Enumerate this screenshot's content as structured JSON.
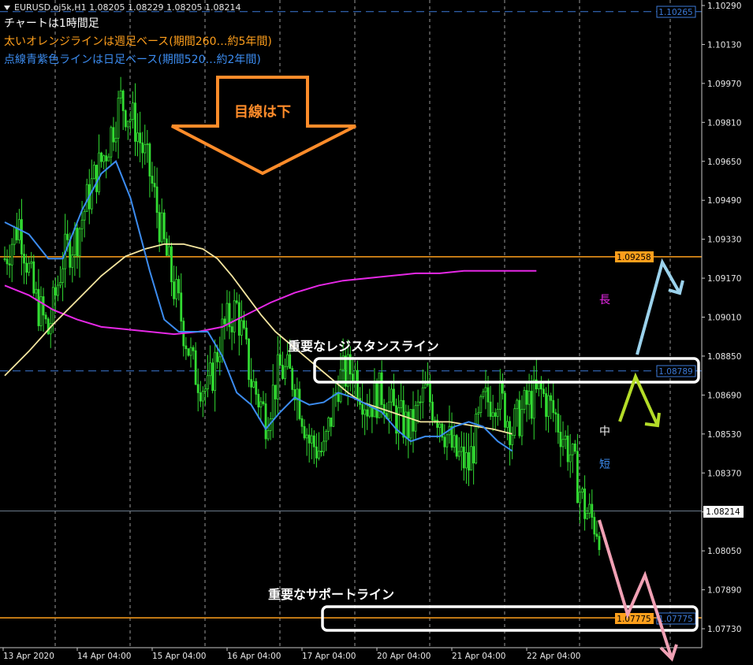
{
  "header": {
    "symbol_line": "EURUSD.oj5k,H1  1.08205 1.08229 1.08205 1.08214",
    "line1": "チャートは1時間足",
    "line2": "太いオレンジラインは週足ベース(期間260…約5年間)",
    "line3": "点線青紫色ラインは日足ベース(期間520…約2年間)"
  },
  "annotations": {
    "arrow_text": "目線は下",
    "resistance": "重要なレジスタンスライン",
    "support": "重要なサポートライン",
    "ma_long": "長",
    "ma_mid": "中",
    "ma_short": "短"
  },
  "price_labels": {
    "top_blue": "1.10265",
    "orange_upper": "1.09258",
    "blue_mid": "1.08789",
    "current": "1.08214",
    "orange_lower": "1.07775",
    "blue_lower": "1.07775"
  },
  "colors": {
    "background": "#000000",
    "candle": "#32dc32",
    "ma_short": "#3c8cf0",
    "ma_mid": "#f5e6a0",
    "ma_long": "#e628e6",
    "orange_line": "#ff9f1c",
    "blue_dash": "#3c7ad8",
    "arrow_orange": "#ff8c2a",
    "arrow_lightblue": "#9bd2ec",
    "arrow_yellowgreen": "#b4dc28",
    "arrow_pink": "#f0a0b4"
  },
  "chart_data": {
    "type": "candlestick",
    "timeframe": "H1",
    "ylim": [
      1.0765,
      1.1031
    ],
    "y_ticks": [
      "1.10290",
      "1.10130",
      "1.09970",
      "1.09810",
      "1.09650",
      "1.09490",
      "1.09330",
      "1.09170",
      "1.09010",
      "1.08850",
      "1.08690",
      "1.08530",
      "1.08370",
      "1.08210",
      "1.08050",
      "1.07890",
      "1.07730"
    ],
    "x_ticks": [
      "13 Apr 2020",
      "14 Apr 04:00",
      "15 Apr 04:00",
      "16 Apr 04:00",
      "17 Apr 04:00",
      "20 Apr 04:00",
      "21 Apr 04:00",
      "22 Apr 04:00"
    ],
    "last": {
      "open": 1.08205,
      "high": 1.08229,
      "low": 1.08205,
      "close": 1.08214
    },
    "horizontal_lines": [
      {
        "value": 1.10265,
        "style": "dashed",
        "color": "blue"
      },
      {
        "value": 1.09258,
        "style": "solid",
        "color": "orange"
      },
      {
        "value": 1.08789,
        "style": "dashed",
        "color": "blue"
      },
      {
        "value": 1.07775,
        "style": "solid",
        "color": "orange"
      }
    ],
    "close_path": [
      [
        0,
        1.0925
      ],
      [
        6,
        1.094
      ],
      [
        12,
        1.091
      ],
      [
        18,
        1.0895
      ],
      [
        24,
        1.0925
      ],
      [
        30,
        1.0935
      ],
      [
        36,
        1.0955
      ],
      [
        42,
        1.097
      ],
      [
        48,
        1.099
      ],
      [
        54,
        1.098
      ],
      [
        60,
        1.096
      ],
      [
        66,
        1.093
      ],
      [
        72,
        1.0905
      ],
      [
        78,
        1.088
      ],
      [
        84,
        1.087
      ],
      [
        90,
        1.0895
      ],
      [
        96,
        1.0905
      ],
      [
        102,
        1.0875
      ],
      [
        108,
        1.086
      ],
      [
        114,
        1.088
      ],
      [
        120,
        1.0875
      ],
      [
        126,
        1.085
      ],
      [
        132,
        1.0845
      ],
      [
        138,
        1.0875
      ],
      [
        144,
        1.088
      ],
      [
        150,
        1.0865
      ],
      [
        156,
        1.087
      ],
      [
        162,
        1.086
      ],
      [
        168,
        1.0855
      ],
      [
        174,
        1.087
      ],
      [
        180,
        1.086
      ],
      [
        186,
        1.0845
      ],
      [
        192,
        1.084
      ],
      [
        198,
        1.0865
      ],
      [
        204,
        1.087
      ],
      [
        210,
        1.0855
      ],
      [
        216,
        1.0865
      ],
      [
        222,
        1.087
      ],
      [
        228,
        1.086
      ],
      [
        234,
        1.0845
      ],
      [
        240,
        1.0822
      ],
      [
        246,
        1.0814
      ]
    ],
    "ma_short": [
      [
        0,
        1.094
      ],
      [
        10,
        1.0935
      ],
      [
        18,
        1.0925
      ],
      [
        24,
        1.0925
      ],
      [
        32,
        1.0945
      ],
      [
        40,
        1.096
      ],
      [
        46,
        1.0965
      ],
      [
        52,
        1.095
      ],
      [
        60,
        1.092
      ],
      [
        66,
        1.09
      ],
      [
        72,
        1.0895
      ],
      [
        78,
        1.0895
      ],
      [
        84,
        1.0895
      ],
      [
        90,
        1.0885
      ],
      [
        96,
        1.087
      ],
      [
        102,
        1.0865
      ],
      [
        108,
        1.0855
      ],
      [
        114,
        1.0862
      ],
      [
        120,
        1.0868
      ],
      [
        126,
        1.0865
      ],
      [
        132,
        1.0866
      ],
      [
        138,
        1.087
      ],
      [
        144,
        1.0868
      ],
      [
        150,
        1.0865
      ],
      [
        156,
        1.0862
      ],
      [
        162,
        1.0855
      ],
      [
        168,
        1.085
      ],
      [
        174,
        1.0852
      ],
      [
        180,
        1.0852
      ],
      [
        186,
        1.0856
      ],
      [
        192,
        1.0858
      ],
      [
        198,
        1.0856
      ],
      [
        204,
        1.085
      ],
      [
        210,
        1.0846
      ]
    ],
    "ma_mid": [
      [
        0,
        1.0877
      ],
      [
        10,
        1.0887
      ],
      [
        20,
        1.0898
      ],
      [
        30,
        1.0908
      ],
      [
        40,
        1.0918
      ],
      [
        50,
        1.0926
      ],
      [
        58,
        1.0929
      ],
      [
        66,
        1.0931
      ],
      [
        74,
        1.0931
      ],
      [
        82,
        1.0929
      ],
      [
        88,
        1.0925
      ],
      [
        94,
        1.0918
      ],
      [
        100,
        1.091
      ],
      [
        106,
        1.0902
      ],
      [
        112,
        1.0895
      ],
      [
        118,
        1.089
      ],
      [
        124,
        1.0885
      ],
      [
        130,
        1.088
      ],
      [
        136,
        1.0875
      ],
      [
        142,
        1.087
      ],
      [
        148,
        1.0866
      ],
      [
        154,
        1.0864
      ],
      [
        160,
        1.0862
      ],
      [
        166,
        1.086
      ],
      [
        172,
        1.0858
      ],
      [
        178,
        1.0858
      ],
      [
        184,
        1.0858
      ],
      [
        190,
        1.0857
      ],
      [
        196,
        1.0856
      ],
      [
        202,
        1.0855
      ],
      [
        210,
        1.0853
      ]
    ],
    "ma_long": [
      [
        0,
        1.0914
      ],
      [
        10,
        1.091
      ],
      [
        20,
        1.0904
      ],
      [
        30,
        1.09
      ],
      [
        40,
        1.0897
      ],
      [
        50,
        1.0896
      ],
      [
        60,
        1.0895
      ],
      [
        70,
        1.0894
      ],
      [
        80,
        1.0895
      ],
      [
        90,
        1.0897
      ],
      [
        100,
        1.0902
      ],
      [
        110,
        1.0907
      ],
      [
        120,
        1.0911
      ],
      [
        130,
        1.0914
      ],
      [
        140,
        1.0916
      ],
      [
        150,
        1.0917
      ],
      [
        160,
        1.0918
      ],
      [
        170,
        1.0919
      ],
      [
        180,
        1.0919
      ],
      [
        190,
        1.092
      ],
      [
        200,
        1.092
      ],
      [
        210,
        1.092
      ],
      [
        220,
        1.092
      ]
    ]
  }
}
